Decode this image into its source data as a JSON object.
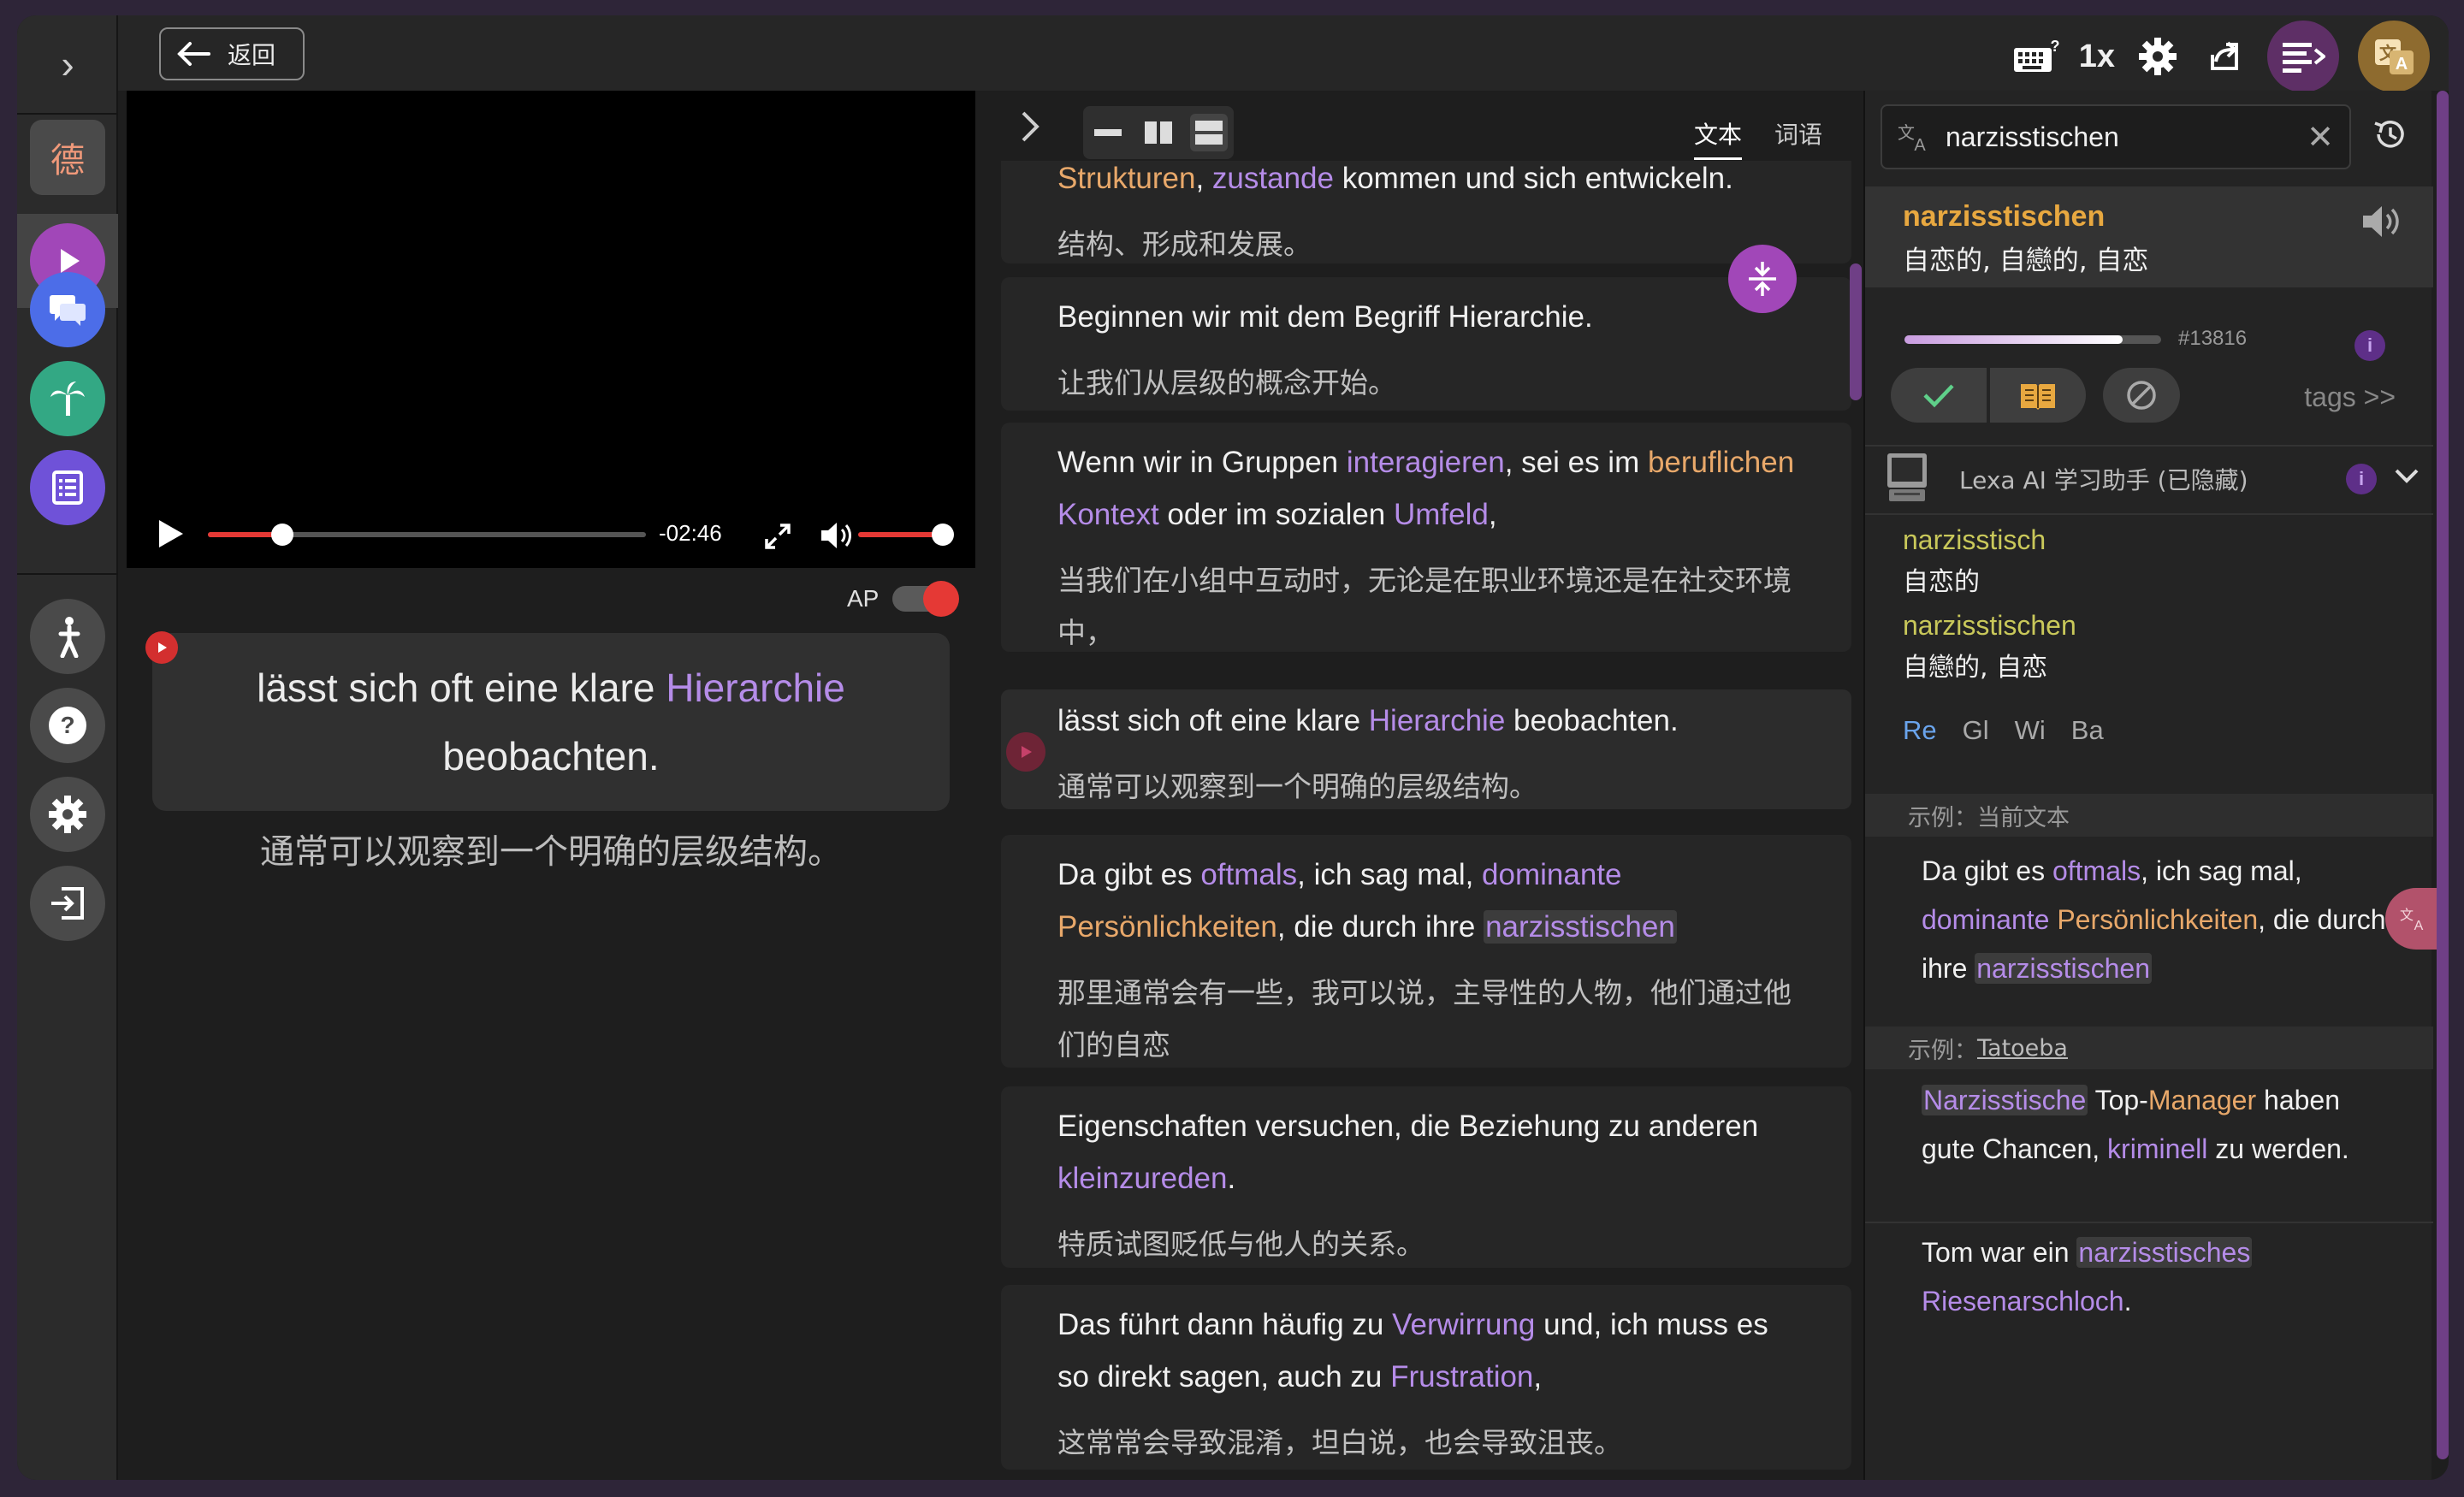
{
  "rail": {
    "toggle": "›",
    "lang_char": "德",
    "items": [
      "play",
      "chat",
      "palm",
      "list",
      "lesson",
      "help",
      "settings",
      "logout"
    ]
  },
  "topbar": {
    "back_label": "返回",
    "speed": "1x",
    "icons": [
      "keyboard-help-icon",
      "gear-icon",
      "share-icon",
      "dictionary-panel-icon",
      "translate-icon"
    ]
  },
  "video": {
    "time_remaining": "-02:46",
    "progress": 0.17,
    "volume": 1.0
  },
  "subtitle": {
    "ap_label": "AP",
    "de_parts": [
      {
        "t": "lässt sich oft eine klare ",
        "c": ""
      },
      {
        "t": "Hierarchie",
        "c": "hl-purple"
      },
      {
        "t": " beobachten.",
        "c": ""
      }
    ],
    "zh": "通常可以观察到一个明确的层级结构。"
  },
  "transcript": {
    "tabs": [
      "文本",
      "词语"
    ],
    "segments": [
      {
        "de_parts": [
          {
            "t": "Strukturen",
            "c": "hl-orange"
          },
          {
            "t": ", ",
            "c": ""
          },
          {
            "t": "zustande",
            "c": "hl-purple"
          },
          {
            "t": " kommen und sich entwickeln.",
            "c": ""
          }
        ],
        "zh": "结构、形成和发展。"
      },
      {
        "de_parts": [
          {
            "t": "Beginnen wir mit dem Begriff Hierarchie.",
            "c": ""
          }
        ],
        "zh": "让我们从层级的概念开始。"
      },
      {
        "de_parts": [
          {
            "t": "Wenn wir in Gruppen ",
            "c": ""
          },
          {
            "t": "interagieren",
            "c": "hl-purple"
          },
          {
            "t": ", sei es im ",
            "c": ""
          },
          {
            "t": "beruflichen",
            "c": "hl-orange"
          },
          {
            "t": " ",
            "c": ""
          },
          {
            "t": "Kontext",
            "c": "hl-purple"
          },
          {
            "t": " oder im sozialen ",
            "c": ""
          },
          {
            "t": "Umfeld",
            "c": "hl-purple"
          },
          {
            "t": ",",
            "c": ""
          }
        ],
        "zh": "当我们在小组中互动时，无论是在职业环境还是在社交环境中，"
      },
      {
        "de_parts": [
          {
            "t": "lässt sich oft eine klare ",
            "c": ""
          },
          {
            "t": "Hierarchie",
            "c": "hl-purple"
          },
          {
            "t": " beobachten.",
            "c": ""
          }
        ],
        "zh": "通常可以观察到一个明确的层级结构。"
      },
      {
        "de_parts": [
          {
            "t": "Da gibt es ",
            "c": ""
          },
          {
            "t": "oftmals",
            "c": "hl-purple"
          },
          {
            "t": ", ich sag mal, ",
            "c": ""
          },
          {
            "t": "dominante",
            "c": "hl-purple"
          },
          {
            "t": " ",
            "c": ""
          },
          {
            "t": "Persönlichkeiten",
            "c": "hl-orange"
          },
          {
            "t": ", die durch ihre ",
            "c": ""
          },
          {
            "t": "narzisstischen",
            "c": "hl-purple boxed"
          }
        ],
        "zh": "那里通常会有一些，我可以说，主导性的人物，他们通过他们的自恋"
      },
      {
        "de_parts": [
          {
            "t": "Eigenschaften versuchen, die Beziehung zu anderen ",
            "c": ""
          },
          {
            "t": "kleinzureden",
            "c": "hl-purple"
          },
          {
            "t": ".",
            "c": ""
          }
        ],
        "zh": "特质试图贬低与他人的关系。"
      },
      {
        "de_parts": [
          {
            "t": "Das führt dann häufig zu ",
            "c": ""
          },
          {
            "t": "Verwirrung",
            "c": "hl-purple"
          },
          {
            "t": " und, ich muss es so direkt sagen, auch zu ",
            "c": ""
          },
          {
            "t": "Frustration",
            "c": "hl-purple"
          },
          {
            "t": ",",
            "c": ""
          }
        ],
        "zh": "这常常会导致混淆，坦白说，也会导致沮丧。"
      }
    ]
  },
  "dictionary": {
    "search_value": "narzisstischen",
    "headword": "narzisstischen",
    "gloss": "自恋的, 自戀的, 自恋",
    "rank": "#13816",
    "known_level": 0.85,
    "tags_label": "tags >>",
    "ai_label": "Lexa AI 学习助手 (已隐藏)",
    "lemmas": [
      {
        "w": "narzisstisch",
        "g": "自恋的"
      },
      {
        "w": "narzisstischen",
        "g": "自戀的, 自恋"
      }
    ],
    "sources": [
      "Re",
      "Gl",
      "Wi",
      "Ba"
    ],
    "example_current_label": "示例：当前文本",
    "example_current_parts": [
      {
        "t": "Da gibt es ",
        "c": ""
      },
      {
        "t": "oftmals",
        "c": "hl-purple"
      },
      {
        "t": ", ich sag mal, ",
        "c": ""
      },
      {
        "t": "dominante",
        "c": "hl-purple"
      },
      {
        "t": " ",
        "c": ""
      },
      {
        "t": "Persönlichkeiten",
        "c": "hl-orange"
      },
      {
        "t": ", die durch ihre ",
        "c": ""
      },
      {
        "t": "narzisstischen",
        "c": "hl-purple boxed"
      }
    ],
    "example_tatoeba_label": "示例：",
    "example_tatoeba_link": "Tatoeba",
    "tatoeba_1_parts": [
      {
        "t": "Narzisstische",
        "c": "hl-purple boxed"
      },
      {
        "t": " Top-",
        "c": ""
      },
      {
        "t": "Manager",
        "c": "hl-orange"
      },
      {
        "t": " haben gute Chancen, ",
        "c": ""
      },
      {
        "t": "kriminell",
        "c": "hl-purple"
      },
      {
        "t": " zu werden.",
        "c": ""
      }
    ],
    "tatoeba_2_parts": [
      {
        "t": "Tom war ein ",
        "c": ""
      },
      {
        "t": "narzisstisches",
        "c": "hl-purple boxed"
      },
      {
        "t": " ",
        "c": ""
      },
      {
        "t": "Riesenarschloch",
        "c": "hl-purple"
      },
      {
        "t": ".",
        "c": ""
      }
    ]
  },
  "colors": {
    "accent_purple": "#a147b8",
    "highlight_purple": "#b58ce8",
    "highlight_orange": "#e8a86a",
    "headword_gold": "#e8a840",
    "red": "#e53935"
  }
}
